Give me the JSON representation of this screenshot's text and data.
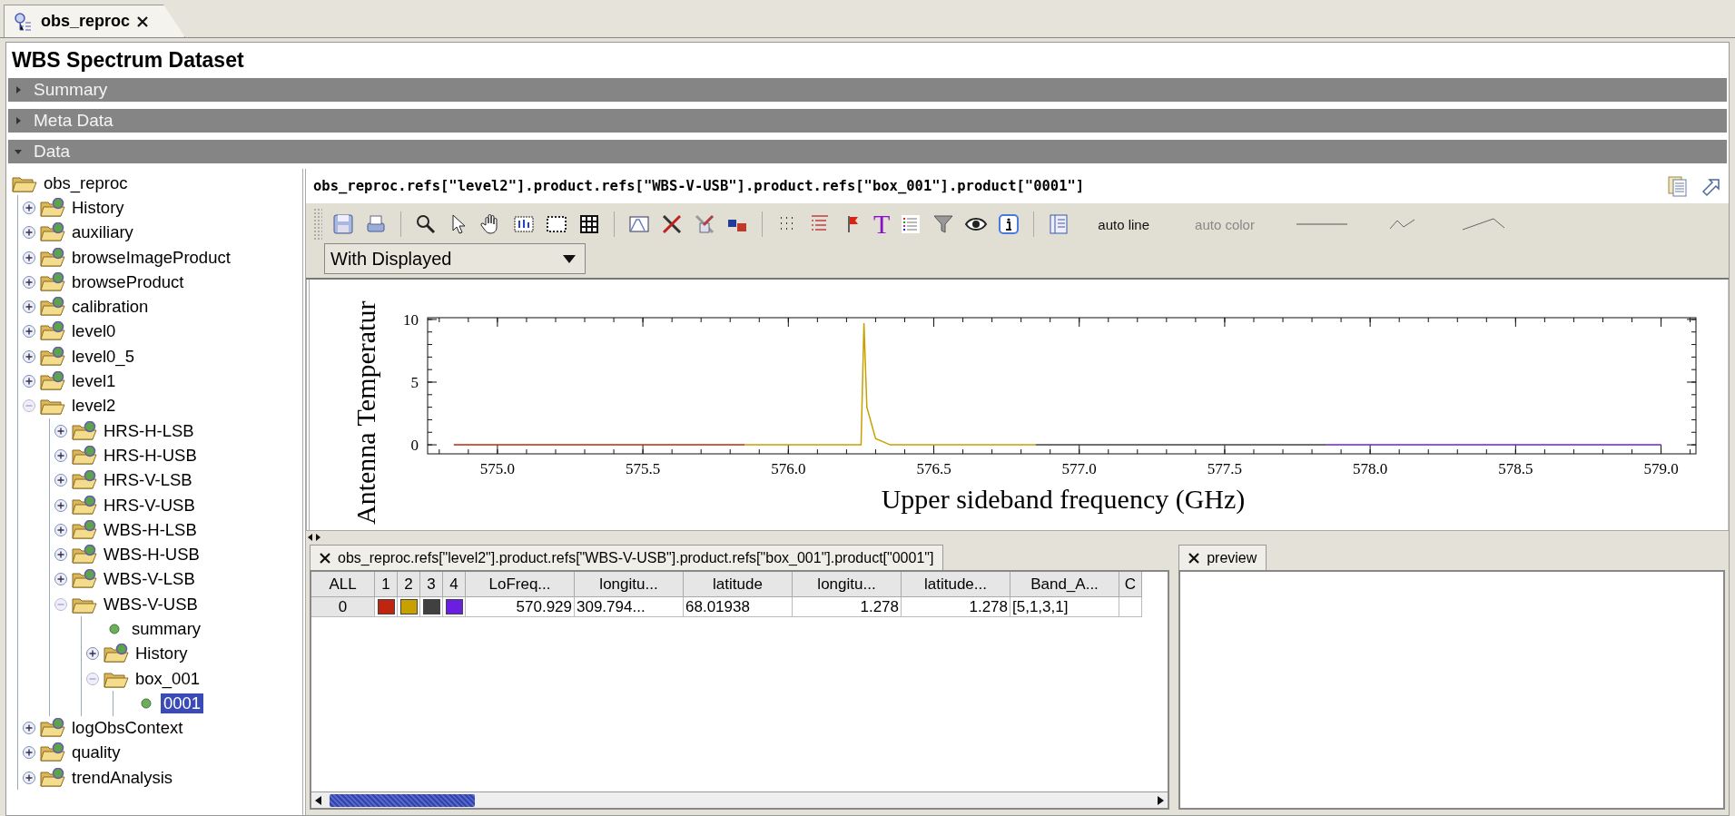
{
  "tabs": [
    {
      "label": "obs_reproc",
      "selected": true
    }
  ],
  "title": "WBS Spectrum Dataset",
  "sections": [
    {
      "label": "Summary",
      "expanded": false
    },
    {
      "label": "Meta Data",
      "expanded": false
    },
    {
      "label": "Data",
      "expanded": true
    }
  ],
  "tree": [
    {
      "label": "obs_reproc",
      "kind": "folder",
      "selected": false,
      "children": [
        {
          "label": "History",
          "kind": "product",
          "expanded": false,
          "selected": false
        },
        {
          "label": "auxiliary",
          "kind": "product",
          "expanded": false,
          "selected": false
        },
        {
          "label": "browseImageProduct",
          "kind": "product",
          "expanded": false,
          "selected": false
        },
        {
          "label": "browseProduct",
          "kind": "product",
          "expanded": false,
          "selected": false
        },
        {
          "label": "calibration",
          "kind": "product",
          "expanded": false,
          "selected": false
        },
        {
          "label": "level0",
          "kind": "product",
          "expanded": false,
          "selected": false
        },
        {
          "label": "level0_5",
          "kind": "product",
          "expanded": false,
          "selected": false
        },
        {
          "label": "level1",
          "kind": "product",
          "expanded": false,
          "selected": false
        },
        {
          "label": "level2",
          "kind": "folder",
          "expanded": true,
          "selected": false,
          "children": [
            {
              "label": "HRS-H-LSB",
              "kind": "product",
              "expanded": false,
              "selected": false
            },
            {
              "label": "HRS-H-USB",
              "kind": "product",
              "expanded": false,
              "selected": false
            },
            {
              "label": "HRS-V-LSB",
              "kind": "product",
              "expanded": false,
              "selected": false
            },
            {
              "label": "HRS-V-USB",
              "kind": "product",
              "expanded": false,
              "selected": false
            },
            {
              "label": "WBS-H-LSB",
              "kind": "product",
              "expanded": false,
              "selected": false
            },
            {
              "label": "WBS-H-USB",
              "kind": "product",
              "expanded": false,
              "selected": false
            },
            {
              "label": "WBS-V-LSB",
              "kind": "product",
              "expanded": false,
              "selected": false
            },
            {
              "label": "WBS-V-USB",
              "kind": "folder",
              "expanded": true,
              "selected": false,
              "children": [
                {
                  "label": "summary",
                  "kind": "leaf",
                  "selected": false
                },
                {
                  "label": "History",
                  "kind": "product",
                  "expanded": false,
                  "selected": false
                },
                {
                  "label": "box_001",
                  "kind": "folder",
                  "expanded": true,
                  "selected": false,
                  "children": [
                    {
                      "label": "0001",
                      "kind": "leaf",
                      "selected": true
                    }
                  ]
                }
              ]
            }
          ]
        },
        {
          "label": "logObsContext",
          "kind": "product",
          "expanded": false,
          "selected": false
        },
        {
          "label": "quality",
          "kind": "product",
          "expanded": false,
          "selected": false
        },
        {
          "label": "trendAnalysis",
          "kind": "product",
          "expanded": false,
          "selected": false
        }
      ]
    }
  ],
  "path": "obs_reproc.refs[\"level2\"].product.refs[\"WBS-V-USB\"].product.refs[\"box_001\"].product[\"0001\"]",
  "toolbar": {
    "glyph": "T",
    "labels": [
      {
        "label": "auto line",
        "disabled": false
      },
      {
        "label": "auto color",
        "disabled": true
      }
    ]
  },
  "dropdown": {
    "value": "With Displayed"
  },
  "chart_data": {
    "type": "line",
    "xlabel": "Upper sideband frequency (GHz)",
    "ylabel": "Antenna Temperatur",
    "x": [
      574.85,
      575.85,
      576.2,
      576.25,
      576.26,
      576.27,
      576.3,
      576.35,
      576.85,
      577.85,
      579.0
    ],
    "series": [
      {
        "color": "#c0260f",
        "values": [
          0,
          0,
          null,
          null,
          null,
          null,
          null,
          null,
          null,
          null,
          null
        ]
      },
      {
        "color": "#c8a000",
        "values": [
          null,
          0,
          0,
          0,
          9.7,
          3,
          0.5,
          0,
          0,
          null,
          null
        ]
      },
      {
        "color": "#404040",
        "values": [
          null,
          null,
          null,
          null,
          null,
          null,
          null,
          null,
          0,
          0,
          null
        ]
      },
      {
        "color": "#6a1ee0",
        "values": [
          null,
          null,
          null,
          null,
          null,
          null,
          null,
          null,
          null,
          0,
          0
        ]
      }
    ],
    "xlim": [
      574.76,
      579.12
    ],
    "ylim": [
      -0.72,
      10.14
    ],
    "xticks": [
      {
        "value": 575,
        "label": "575.0"
      },
      {
        "value": 575.5,
        "label": "575.5"
      },
      {
        "value": 576,
        "label": "576.0"
      },
      {
        "value": 576.5,
        "label": "576.5"
      },
      {
        "value": 577,
        "label": "577.0"
      },
      {
        "value": 577.5,
        "label": "577.5"
      },
      {
        "value": 578,
        "label": "578.0"
      },
      {
        "value": 578.5,
        "label": "578.5"
      },
      {
        "value": 579,
        "label": "579.0"
      }
    ],
    "yticks": [
      0,
      5,
      10
    ]
  },
  "table_tab": {
    "label": "obs_reproc.refs[\"level2\"].product.refs[\"WBS-V-USB\"].product.refs[\"box_001\"].product[\"0001\"]",
    "selected": true
  },
  "table": {
    "columns": [
      "ALL",
      "1",
      "2",
      "3",
      "4",
      "LoFreq...",
      "longitu...",
      "latitude",
      "longitu...",
      "latitude...",
      "Band_A...",
      "C"
    ],
    "rows": [
      {
        "cells": [
          {
            "kind": "index",
            "text": "0"
          },
          {
            "kind": "color",
            "color": "#c0260f"
          },
          {
            "kind": "color",
            "color": "#c8a000"
          },
          {
            "kind": "color",
            "color": "#404040"
          },
          {
            "kind": "color",
            "color": "#6a1ee0"
          },
          {
            "kind": "number",
            "text": "570.929"
          },
          {
            "kind": "text",
            "text": "309.794..."
          },
          {
            "kind": "text",
            "text": "68.01938"
          },
          {
            "kind": "number",
            "text": "1.278"
          },
          {
            "kind": "number",
            "text": "1.278"
          },
          {
            "kind": "text",
            "text": "[5,1,3,1]"
          },
          {
            "kind": "empty"
          }
        ]
      }
    ]
  },
  "preview_tab": {
    "label": "preview",
    "selected": true
  }
}
